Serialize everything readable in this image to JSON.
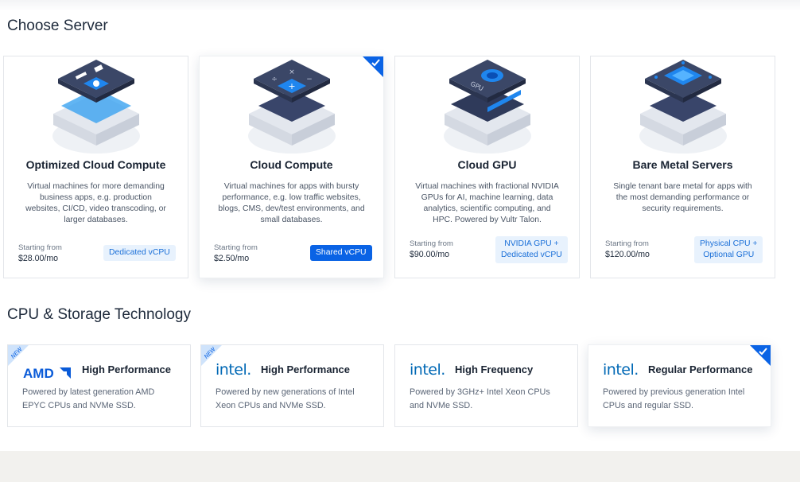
{
  "sections": {
    "choose_server": "Choose Server",
    "cpu_storage": "CPU & Storage Technology"
  },
  "servers": [
    {
      "name": "Optimized Cloud Compute",
      "description": "Virtual machines for more demanding business apps, e.g. production websites, CI/CD, video transcoding, or larger databases.",
      "starting_label": "Starting from",
      "price": "$28.00/mo",
      "tag": "Dedicated vCPU",
      "selected": false
    },
    {
      "name": "Cloud Compute",
      "description": "Virtual machines for apps with bursty performance, e.g. low traffic websites, blogs, CMS, dev/test environments, and small databases.",
      "starting_label": "Starting from",
      "price": "$2.50/mo",
      "tag": "Shared vCPU",
      "selected": true
    },
    {
      "name": "Cloud GPU",
      "description": "Virtual machines with fractional NVIDIA GPUs for AI, machine learning, data analytics, scientific computing, and HPC. Powered by Vultr Talon.",
      "starting_label": "Starting from",
      "price": "$90.00/mo",
      "tag_line1": "NVIDIA GPU +",
      "tag_line2": "Dedicated vCPU",
      "illus_text": "GPU",
      "selected": false
    },
    {
      "name": "Bare Metal Servers",
      "description": "Single tenant bare metal for apps with the most demanding performance or security requirements.",
      "starting_label": "Starting from",
      "price": "$120.00/mo",
      "tag_line1": "Physical CPU +",
      "tag_line2": "Optional GPU",
      "selected": false
    }
  ],
  "tech": [
    {
      "logo": "AMD",
      "name": "High Performance",
      "description": "Powered by latest generation AMD EPYC CPUs and NVMe SSD.",
      "badge": "NEW",
      "selected": false
    },
    {
      "logo": "intel.",
      "name": "High Performance",
      "description": "Powered by new generations of Intel Xeon CPUs and NVMe SSD.",
      "badge": "NEW",
      "selected": false
    },
    {
      "logo": "intel.",
      "name": "High Frequency",
      "description": "Powered by 3GHz+ Intel Xeon CPUs and NVMe SSD.",
      "selected": false
    },
    {
      "logo": "intel.",
      "name": "Regular Performance",
      "description": "Powered by previous generation Intel CPUs and regular SSD.",
      "selected": true
    }
  ],
  "colors": {
    "accent": "#0a63e5",
    "tag_bg": "#e8f2fd",
    "intel_blue": "#0068b5",
    "amd_blue": "#0a5bd8"
  },
  "icons": {
    "check": "check-icon",
    "server_illustrations": [
      "optimized-compute-illustration",
      "cloud-compute-illustration",
      "gpu-illustration",
      "bare-metal-illustration"
    ]
  }
}
